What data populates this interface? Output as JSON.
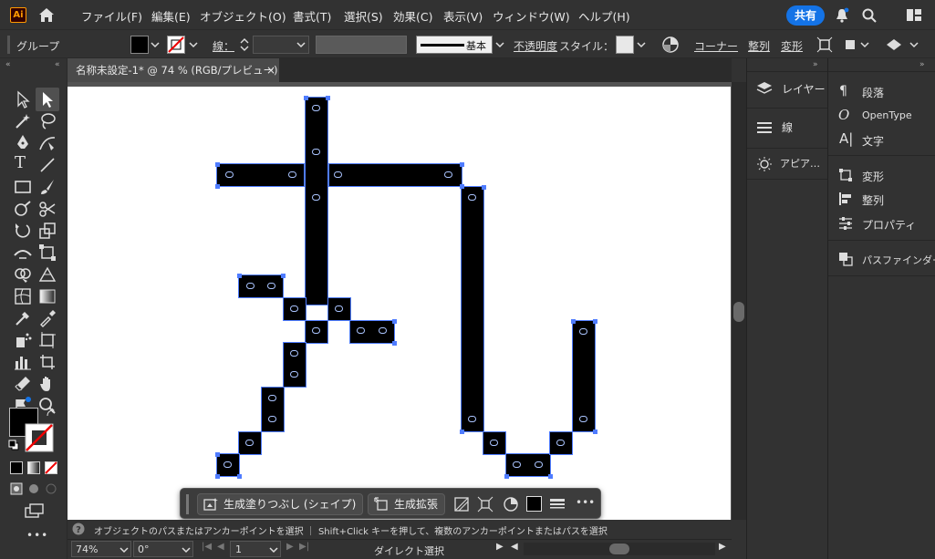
{
  "app": {
    "logo": "Ai"
  },
  "menu": {
    "items": [
      "ファイル(F)",
      "編集(E)",
      "オブジェクト(O)",
      "書式(T)",
      "選択(S)",
      "効果(C)",
      "表示(V)",
      "ウィンドウ(W)",
      "ヘルプ(H)"
    ],
    "share_label": "共有"
  },
  "control": {
    "selection_label": "グループ",
    "stroke_label": "線：",
    "stroke_style": "基本",
    "opacity_label": "不透明度",
    "style_label": "スタイル：",
    "corner_label": "コーナー",
    "align_label": "整列",
    "transform_label": "変形"
  },
  "document": {
    "tab_title": "名称未設定-1* @ 74 % (RGB/プレビュー)",
    "close_glyph": "×"
  },
  "panels": {
    "column_a": [
      "レイヤー",
      "線",
      "アピア…"
    ],
    "column_b": [
      "段落",
      "OpenType",
      "文字",
      "変形",
      "整列",
      "プロパティ",
      "パスファインダー"
    ]
  },
  "context_bar": {
    "generative_fill": "生成塗りつぶし (シェイプ)",
    "generative_expand": "生成拡張",
    "more": "•••"
  },
  "status": {
    "help_text": "オブジェクトのパスまたはアンカーポイントを選択 ｜ Shift+Click キーを押して、複数のアンカーポイントまたはパスを選択",
    "zoom": "74%",
    "rotation": "0°",
    "artboard_number": "1",
    "tool_name": "ダイレクト選択"
  },
  "colors": {
    "accent": "#1473e6",
    "selection": "#4f7cff",
    "fill": "#000000",
    "ui_bg": "#323232",
    "logo_orange": "#ff9a00"
  }
}
